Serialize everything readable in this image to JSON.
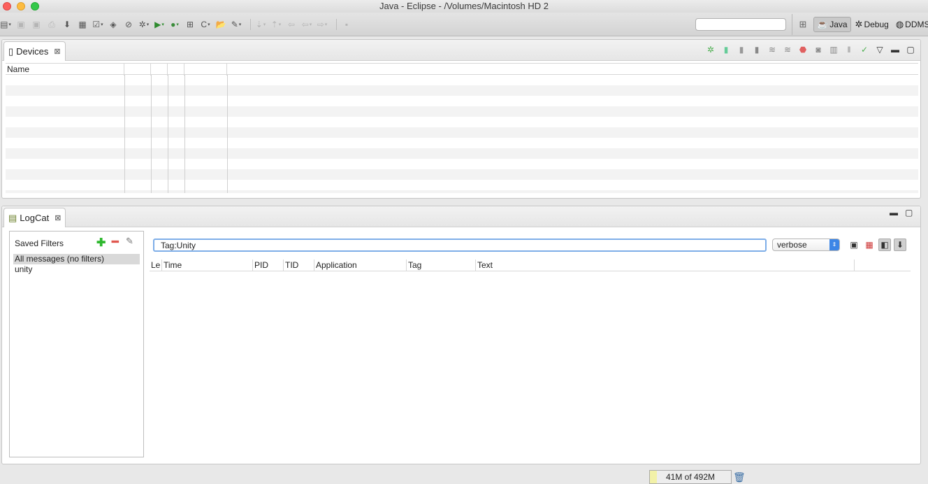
{
  "window": {
    "title": "Java - Eclipse - /Volumes/Macintosh HD 2"
  },
  "toolbar": {
    "icons": [
      "new-icon",
      "save-icon",
      "save-all-icon",
      "print-icon",
      "import-icon",
      "sdk-manager-icon",
      "task-icon",
      "android-icon",
      "skip-breakpoints-icon",
      "debug-icon",
      "run-icon",
      "external-tools-icon",
      "new-class-icon",
      "new-project-icon",
      "open-type-icon",
      "search-icon",
      "next-annotation-icon",
      "previous-annotation-icon",
      "back-icon",
      "forward-icon",
      "pin-editor-icon"
    ],
    "quick_access_value": "",
    "perspectives": [
      {
        "label": "Java",
        "active": true,
        "icon": "java-perspective-icon"
      },
      {
        "label": "Debug",
        "active": false,
        "icon": "debug-perspective-icon"
      },
      {
        "label": "DDMS",
        "active": false,
        "icon": "ddms-perspective-icon"
      }
    ]
  },
  "devices": {
    "tab_label": "Devices",
    "columns": [
      "Name",
      "",
      "",
      "",
      ""
    ],
    "tools": [
      "debug-process-icon",
      "update-heap-icon",
      "dump-hprof-icon",
      "cause-gc-icon",
      "update-threads-icon",
      "start-method-profiling-icon",
      "stop-process-icon",
      "screen-capture-icon",
      "systrace-icon",
      "reset-adb-icon",
      "view-menu-icon"
    ]
  },
  "logcat": {
    "tab_label": "LogCat",
    "saved_filters_title": "Saved Filters",
    "filters": [
      {
        "label": "All messages (no filters)",
        "selected": true
      },
      {
        "label": "unity",
        "selected": false
      }
    ],
    "search_value": "Tag:Unity",
    "level": "verbose",
    "columns": [
      "Le",
      "Time",
      "PID",
      "TID",
      "Application",
      "Tag",
      "Text"
    ]
  },
  "status": {
    "heap": "41M of 492M"
  }
}
